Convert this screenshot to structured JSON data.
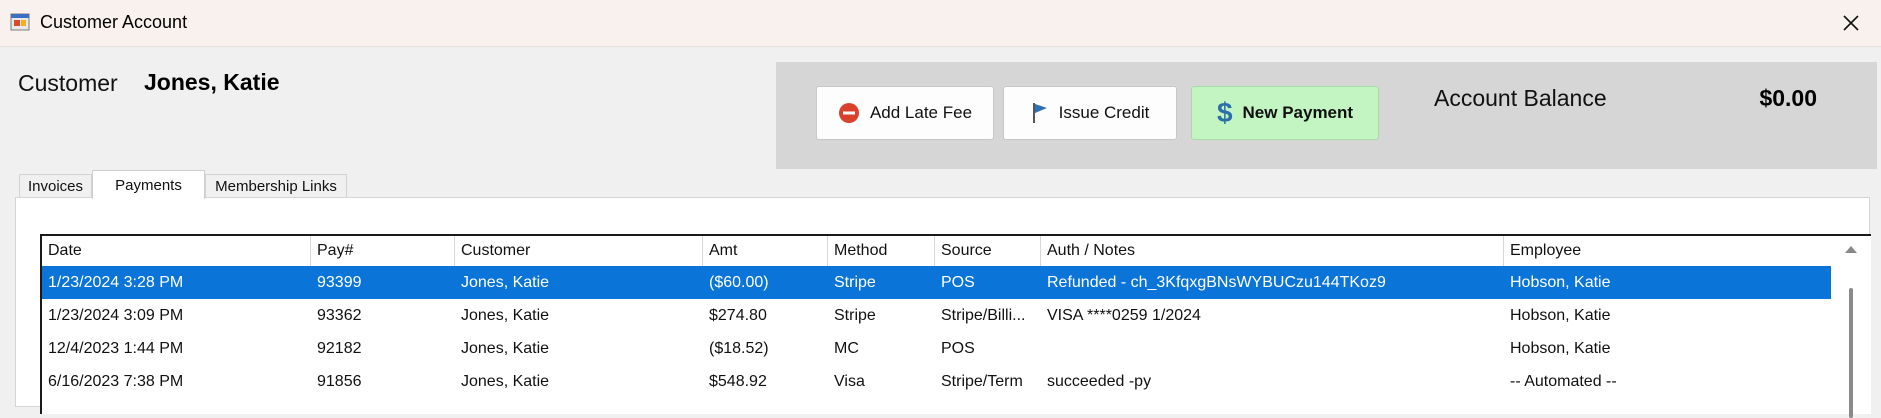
{
  "window": {
    "title": "Customer Account",
    "icon": "windows-form-icon",
    "close_icon": "close-icon"
  },
  "customer": {
    "label": "Customer",
    "name": "Jones, Katie"
  },
  "actions": {
    "late_fee": {
      "label": "Add Late Fee",
      "icon": "minus-circle-icon",
      "icon_color": "#d9412c"
    },
    "issue_credit": {
      "label": "Issue Credit",
      "icon": "flag-icon",
      "icon_color": "#2f6fb5"
    },
    "new_payment": {
      "label": "New Payment",
      "icon": "dollar-icon",
      "icon_glyph": "$",
      "bg_color": "#c3f5c3"
    }
  },
  "balance": {
    "label": "Account Balance",
    "value": "$0.00"
  },
  "tabs": [
    {
      "label": "Invoices",
      "active": false
    },
    {
      "label": "Payments",
      "active": true
    },
    {
      "label": "Membership Links",
      "active": false
    }
  ],
  "grid": {
    "columns": [
      "Date",
      "Pay#",
      "Customer",
      "Amt",
      "Method",
      "Source",
      "Auth / Notes",
      "Employee"
    ],
    "rows": [
      {
        "date": "1/23/2024 3:28 PM",
        "pay": "93399",
        "customer": "Jones, Katie",
        "amt": "($60.00)",
        "method": "Stripe",
        "source": "POS",
        "notes": "Refunded - ch_3KfqxgBNsWYBUCzu144TKoz9",
        "employee": "Hobson, Katie",
        "selected": true
      },
      {
        "date": "1/23/2024 3:09 PM",
        "pay": "93362",
        "customer": "Jones, Katie",
        "amt": "$274.80",
        "method": "Stripe",
        "source": "Stripe/Billi...",
        "notes": "VISA ****0259 1/2024",
        "employee": "Hobson, Katie",
        "selected": false
      },
      {
        "date": "12/4/2023 1:44 PM",
        "pay": "92182",
        "customer": "Jones, Katie",
        "amt": "($18.52)",
        "method": "MC",
        "source": "POS",
        "notes": "",
        "employee": "Hobson, Katie",
        "selected": false
      },
      {
        "date": "6/16/2023 7:38 PM",
        "pay": "91856",
        "customer": "Jones, Katie",
        "amt": "$548.92",
        "method": "Visa",
        "source": "Stripe/Term",
        "notes": "succeeded -py",
        "employee": "-- Automated --",
        "selected": false
      }
    ],
    "selection_color": "#0a74d8"
  }
}
